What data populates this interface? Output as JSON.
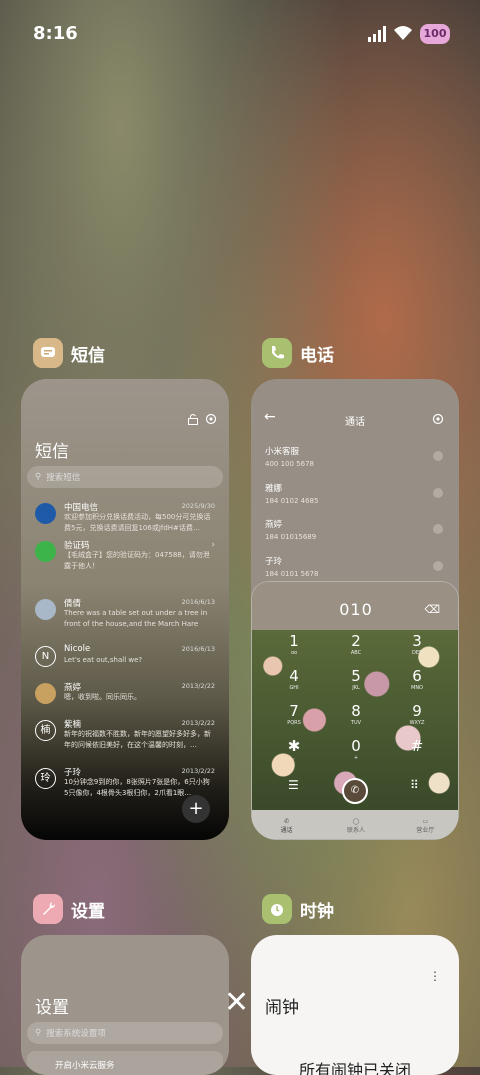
{
  "status": {
    "time": "8:16",
    "battery": "100"
  },
  "apps": {
    "sms": {
      "name": "短信",
      "icon_color": "#c8a878",
      "title": "短信",
      "search_placeholder": "搜索短信",
      "messages": [
        {
          "name": "中国电信",
          "date": "2025/9/30",
          "text": "欢迎参加积分兑换话费活动，每500分可兑换话费5元，兑换话费请回复106或JfdH#话费…",
          "avatar_color": "#1e5aa8"
        },
        {
          "name": "验证码",
          "date": "",
          "text": "【毛绒盒子】您的验证码为：047588，请勿泄露于他人！",
          "avatar_color": "#3cb44a"
        },
        {
          "name": "倩倩",
          "date": "2016/6/13",
          "text": "There was a table set out under a tree in front of the house,and the March Hare an…",
          "avatar_color": "#a8b8c8"
        },
        {
          "name": "Nicole",
          "date": "2016/6/13",
          "text": "Let's eat out,shall we?",
          "avatar_letter": "N"
        },
        {
          "name": "燕婷",
          "date": "2013/2/22",
          "text": "嗯，收到啦。同乐同乐。",
          "avatar_color": "#c8a060"
        },
        {
          "name": "紫楠",
          "date": "2013/2/22",
          "text": "新年的祝福数不胜数，新年的愿望好多好多，新年的问候依旧美好，在这个温馨的时刻，…",
          "avatar_letter": "楠"
        },
        {
          "name": "子玲",
          "date": "2013/2/22",
          "text": "10分钟念9到的你，8张照片7张是你，6只小狗5只像你，4根骨头3根归你，2爪看1眼…",
          "avatar_letter": "玲"
        }
      ]
    },
    "phone": {
      "name": "电话",
      "icon_color": "#a8c070",
      "title": "通话",
      "contacts": [
        {
          "name": "小米客服",
          "number": "400 100 5678"
        },
        {
          "name": "雅娜",
          "number": "184 0102 4685"
        },
        {
          "name": "燕婷",
          "number": "184 01015689"
        },
        {
          "name": "子玲",
          "number": "184 0101 5678"
        }
      ],
      "dial_number": "010",
      "keys": [
        {
          "d": "1",
          "l": "oo"
        },
        {
          "d": "2",
          "l": "ABC"
        },
        {
          "d": "3",
          "l": "DEF"
        },
        {
          "d": "4",
          "l": "GHI"
        },
        {
          "d": "5",
          "l": "JKL"
        },
        {
          "d": "6",
          "l": "MNO"
        },
        {
          "d": "7",
          "l": "PQRS"
        },
        {
          "d": "8",
          "l": "TUV"
        },
        {
          "d": "9",
          "l": "WXYZ"
        },
        {
          "d": "✱",
          "l": ","
        },
        {
          "d": "0",
          "l": "+"
        },
        {
          "d": "#",
          "l": ""
        }
      ],
      "tabs": [
        "通话",
        "联系人",
        "营业厅"
      ]
    },
    "settings": {
      "name": "设置",
      "icon_color": "#e8a0a8",
      "title": "设置",
      "search_placeholder": "搜索系统设置项",
      "first_item": "开启小米云服务"
    },
    "clock": {
      "name": "时钟",
      "icon_color": "#a8c070",
      "title": "闹钟",
      "empty_text": "所有闹钟已关闭"
    }
  }
}
